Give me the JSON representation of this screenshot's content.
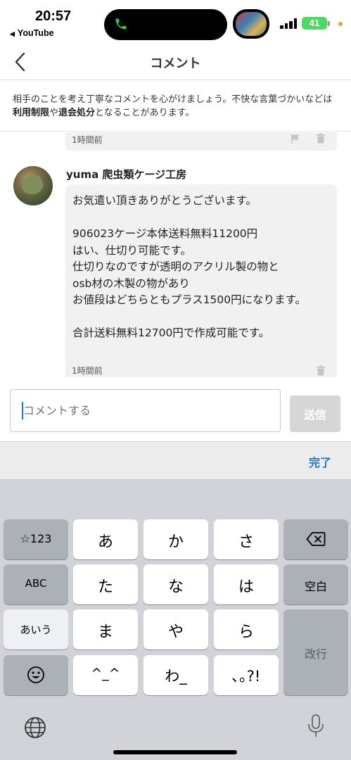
{
  "status_bar": {
    "time": "20:57",
    "back_app": "YouTube",
    "battery": "41"
  },
  "nav": {
    "title": "コメント"
  },
  "notice": {
    "part1": "相手のことを考え丁寧なコメントを心がけましょう。不快な言葉づかいなどは",
    "bold1": "利用制限",
    "part2": "や",
    "bold2": "退会処分",
    "part3": "となることがあります。"
  },
  "comments": {
    "previous": {
      "time": "1時間前"
    },
    "current": {
      "author": "yuma 爬虫類ケージ工房",
      "text": "お気遣い頂きありがとうございます。\n\n906023ケージ本体送料無料11200円\nはい、仕切り可能です。\n仕切りなのですが透明のアクリル製の物と\nosb材の木製の物があり\nお値段はどちらともプラス1500円になります。\n\n合計送料無料12700円で作成可能です。",
      "time": "1時間前"
    }
  },
  "input": {
    "placeholder": "コメントする",
    "send_label": "送信"
  },
  "keyboard": {
    "done_label": "完了",
    "keys": {
      "num": "☆123",
      "a": "あ",
      "ka": "か",
      "sa": "さ",
      "abc": "ABC",
      "ta": "た",
      "na": "な",
      "ha": "は",
      "space": "空白",
      "aiu": "あいう",
      "ma": "ま",
      "ya": "や",
      "ra": "ら",
      "return": "改行",
      "emoji_kao": "^_^",
      "wa": "わ_",
      "punct": "､｡?!"
    }
  }
}
